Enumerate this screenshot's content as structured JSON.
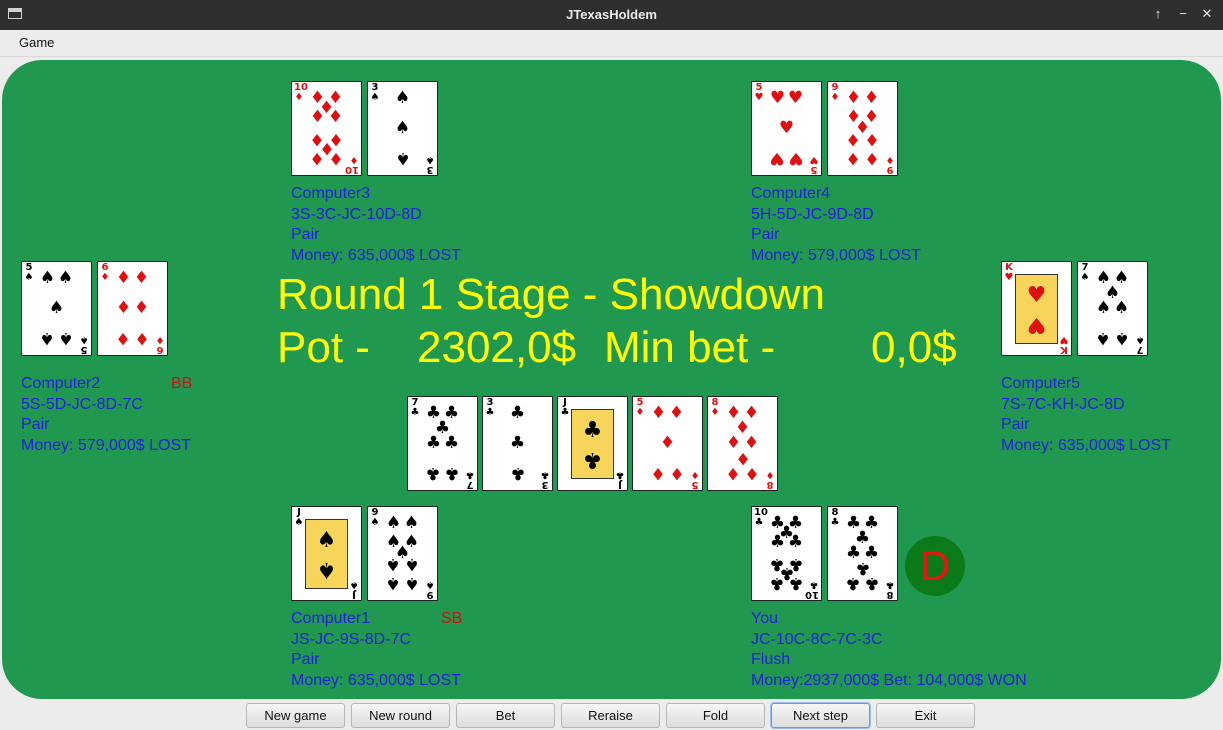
{
  "window": {
    "title": "JTexasHoldem",
    "controls": [
      "↑",
      "−",
      "✕"
    ]
  },
  "menu": {
    "items": [
      "Game"
    ]
  },
  "status": {
    "round_line": "Round 1 Stage - Showdown",
    "pot_label": "Pot -",
    "pot_value": "2302,0$",
    "minbet_label": "Min bet -",
    "minbet_value": "0,0$"
  },
  "players": [
    {
      "name": "Computer3",
      "hand": "3S-3C-JC-10D-8D",
      "rank": "Pair",
      "money": "Money: 635,000$ LOST",
      "tag": "",
      "cards": [
        {
          "rank": "10",
          "suit": "♦",
          "color": "red"
        },
        {
          "rank": "3",
          "suit": "♠",
          "color": "black"
        }
      ]
    },
    {
      "name": "Computer4",
      "hand": "5H-5D-JC-9D-8D",
      "rank": "Pair",
      "money": "Money: 579,000$ LOST",
      "tag": "",
      "cards": [
        {
          "rank": "5",
          "suit": "♥",
          "color": "red"
        },
        {
          "rank": "9",
          "suit": "♦",
          "color": "red"
        }
      ]
    },
    {
      "name": "Computer2",
      "hand": "5S-5D-JC-8D-7C",
      "rank": "Pair",
      "money": "Money: 579,000$ LOST",
      "tag": "BB",
      "cards": [
        {
          "rank": "5",
          "suit": "♠",
          "color": "black"
        },
        {
          "rank": "6",
          "suit": "♦",
          "color": "red"
        }
      ]
    },
    {
      "name": "Computer5",
      "hand": "7S-7C-KH-JC-8D",
      "rank": "Pair",
      "money": "Money: 635,000$ LOST",
      "tag": "",
      "cards": [
        {
          "rank": "K",
          "suit": "♥",
          "color": "red"
        },
        {
          "rank": "7",
          "suit": "♠",
          "color": "black"
        }
      ]
    },
    {
      "name": "Computer1",
      "hand": "JS-JC-9S-8D-7C",
      "rank": "Pair",
      "money": "Money: 635,000$ LOST",
      "tag": "SB",
      "cards": [
        {
          "rank": "J",
          "suit": "♠",
          "color": "black"
        },
        {
          "rank": "9",
          "suit": "♠",
          "color": "black"
        }
      ]
    },
    {
      "name": "You",
      "hand": "JC-10C-8C-7C-3C",
      "rank": "Flush",
      "money": "Money:2937,000$ Bet: 104,000$ WON",
      "tag": "",
      "cards": [
        {
          "rank": "10",
          "suit": "♣",
          "color": "black"
        },
        {
          "rank": "8",
          "suit": "♣",
          "color": "black"
        }
      ]
    }
  ],
  "community_cards": [
    {
      "rank": "7",
      "suit": "♣",
      "color": "black"
    },
    {
      "rank": "3",
      "suit": "♣",
      "color": "black"
    },
    {
      "rank": "J",
      "suit": "♣",
      "color": "black"
    },
    {
      "rank": "5",
      "suit": "♦",
      "color": "red"
    },
    {
      "rank": "8",
      "suit": "♦",
      "color": "red"
    }
  ],
  "dealer_button": "D",
  "buttons": [
    "New game",
    "New round",
    "Bet",
    "Reraise",
    "Fold",
    "Next step",
    "Exit"
  ]
}
